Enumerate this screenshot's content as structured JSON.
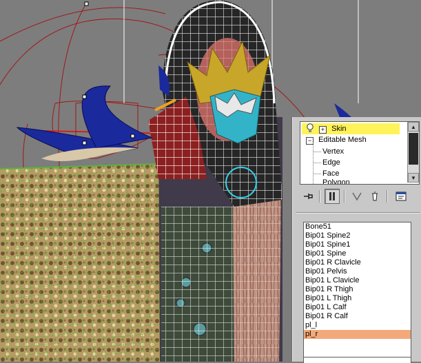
{
  "viewport": {
    "colors": {
      "background": "#7d7d7d",
      "mesh_wire": "#ffffff",
      "grid_wire": "#59b33a",
      "bone_wire": "#a01818"
    }
  },
  "modifier_stack": {
    "items": [
      {
        "label": "Skin",
        "icon": "lightbulb-icon",
        "selected": true
      },
      {
        "label": "Editable Mesh",
        "expanded": true
      }
    ],
    "sub_objects": [
      "Vertex",
      "Edge",
      "Face",
      "Polygon"
    ],
    "highlight_color": "#fff35a"
  },
  "stack_toolbar": {
    "buttons": [
      {
        "icon": "pin-stack-icon"
      },
      {
        "icon": "show-end-result-icon",
        "pressed": true
      },
      {
        "icon": "make-unique-icon"
      },
      {
        "icon": "remove-modifier-icon"
      },
      {
        "icon": "configure-modifier-sets-icon"
      }
    ]
  },
  "bone_list": {
    "items": [
      "Bone51",
      "Bip01 Spine2",
      "Bip01 Spine1",
      "Bip01 Spine",
      "Bip01 R Clavicle",
      "Bip01 Pelvis",
      "Bip01 L Clavicle",
      "Bip01 R Thigh",
      "Bip01 L Thigh",
      "Bip01 L Calf",
      "Bip01 R Calf",
      "pl_l",
      "pl_r"
    ],
    "selected": "pl_r",
    "selected_color": "#f4a97a"
  }
}
